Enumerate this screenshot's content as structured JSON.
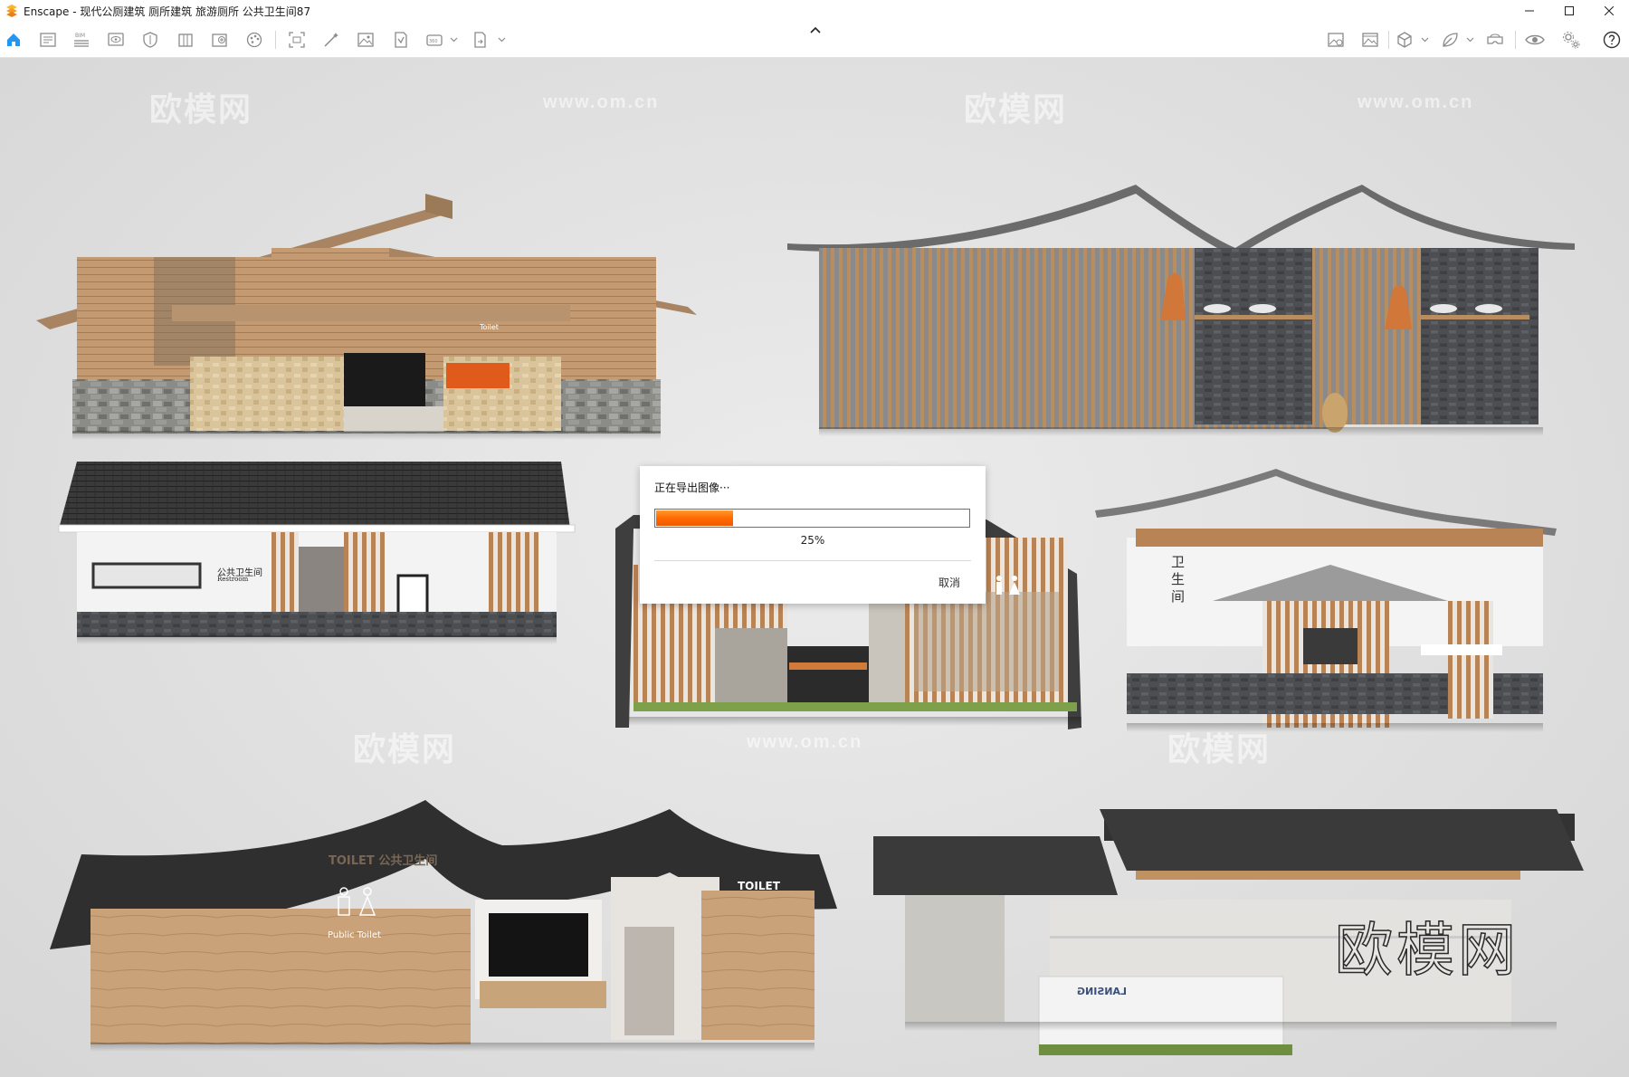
{
  "window": {
    "app_name": "Enscape",
    "separator": " - ",
    "document_title": "现代公厕建筑 厕所建筑 旅游厕所 公共卫生间87"
  },
  "toolbar": {
    "left_icons": [
      "home-icon",
      "document-icon",
      "bim-icon",
      "monitor-eye-icon",
      "shield-icon",
      "asset-library-icon",
      "asset-add-icon",
      "palette-icon",
      "screenshot-icon",
      "magic-wand-icon",
      "image-icon",
      "batch-render-icon",
      "panorama-icon",
      "export-icon"
    ],
    "bim_badge": "BIM",
    "right_icons": [
      "image-editor-icon",
      "gallery-icon",
      "cube-icon",
      "leaf-icon",
      "vr-headset-icon",
      "eye-icon",
      "settings-icon",
      "help-icon"
    ]
  },
  "viewport": {
    "watermarks": [
      "欧模网",
      "www.om.cn"
    ],
    "big_watermark": "欧模网",
    "building_signs": {
      "toilet_plate": "Toilet",
      "restroom_cn": "公共卫生间",
      "restroom_en": "Restroom",
      "vertical_cn": "卫生间",
      "toilet_label": "TOILET",
      "public_cn": "公共卫生间",
      "public_toilet": "Public Toilet",
      "toilet_right": "TOILET",
      "lansing": "LANSING"
    }
  },
  "dialog": {
    "title": "正在导出图像···",
    "progress": 0.25,
    "percent_label": "25%",
    "cancel_label": "取消"
  },
  "colors": {
    "accent": "#ff6a00",
    "enscape_logo": "#f5a623"
  }
}
